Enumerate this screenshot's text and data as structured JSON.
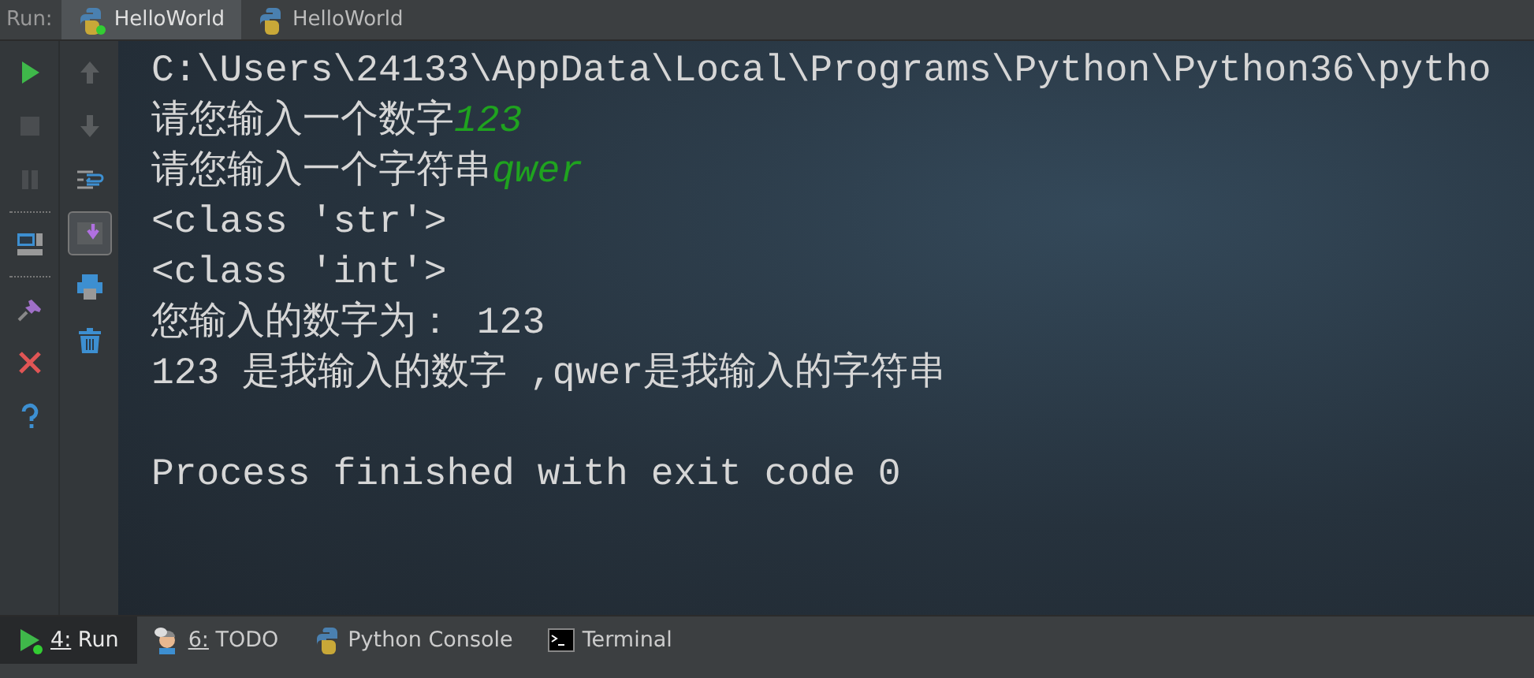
{
  "run_bar": {
    "label": "Run:",
    "tabs": [
      {
        "label": "HelloWorld",
        "running": true,
        "selected": true
      },
      {
        "label": "HelloWorld",
        "running": false,
        "selected": false
      }
    ]
  },
  "toolbar_left": [
    {
      "kind": "run",
      "disabled": false
    },
    {
      "kind": "stop",
      "disabled": true
    },
    {
      "kind": "pause",
      "disabled": true
    },
    {
      "kind": "sep"
    },
    {
      "kind": "layout",
      "disabled": false
    },
    {
      "kind": "sep"
    },
    {
      "kind": "pin",
      "disabled": false
    },
    {
      "kind": "close",
      "disabled": false
    },
    {
      "kind": "help",
      "disabled": false
    }
  ],
  "toolbar_right": [
    {
      "kind": "up",
      "on": false
    },
    {
      "kind": "down",
      "on": false
    },
    {
      "kind": "wrap",
      "on": false
    },
    {
      "kind": "scroll",
      "on": true
    },
    {
      "kind": "print",
      "on": false
    },
    {
      "kind": "trash",
      "on": false
    }
  ],
  "console": [
    {
      "lines": [
        {
          "text": "C:\\Users\\24133\\AppData\\Local\\Programs\\Python\\Python36\\pytho"
        },
        {
          "text": "请您输入一个数字",
          "input": "123"
        },
        {
          "text": "请您输入一个字符串",
          "input": "qwer"
        },
        {
          "text": "<class 'str'>"
        },
        {
          "text": "<class 'int'>"
        },
        {
          "text": "您输入的数字为： 123"
        },
        {
          "text": "123 是我输入的数字 ,qwer是我输入的字符串"
        }
      ]
    },
    {
      "lines": [
        {
          "text": "Process finished with exit code 0"
        }
      ]
    }
  ],
  "bottom_tabs": [
    {
      "kind": "run",
      "label": "4: Run",
      "selected": true
    },
    {
      "kind": "todo",
      "label": "6: TODO",
      "selected": false
    },
    {
      "kind": "python",
      "label": "Python Console",
      "selected": false
    },
    {
      "kind": "terminal",
      "label": "Terminal",
      "selected": false
    }
  ]
}
